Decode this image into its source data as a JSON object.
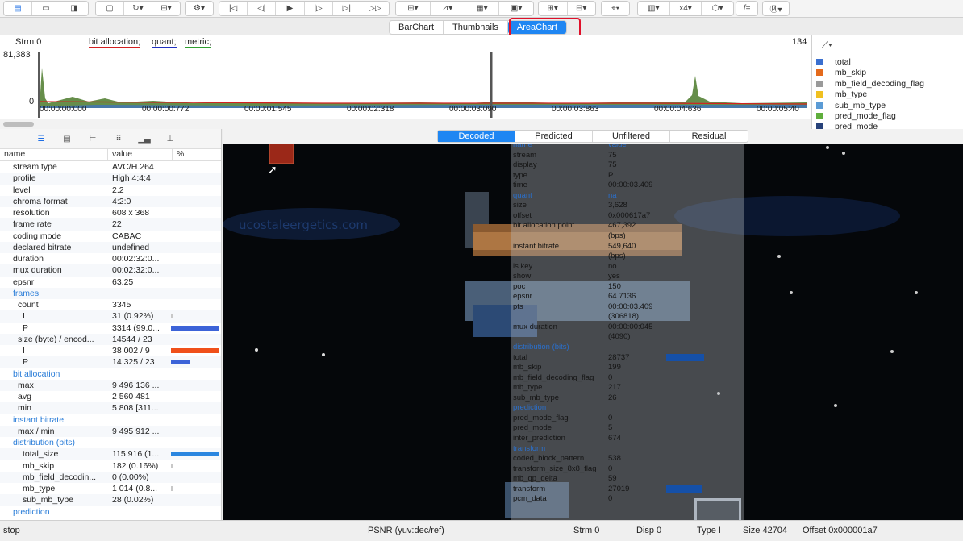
{
  "toolbar": {
    "zoom": "x4",
    "formula": "f="
  },
  "view_tabs": [
    "BarChart",
    "Thumbnails",
    "AreaChart"
  ],
  "chart": {
    "stream_label": "Strm 0",
    "legend_inline": [
      "bit allocation;",
      "quant;",
      "metric;"
    ],
    "right_value": "134",
    "y_max": "81,383",
    "y_zero": "0",
    "time_ticks": [
      "00:00:00:000",
      "00:00:00:772",
      "00:00:01:545",
      "00:00:02:318",
      "00:00:03:090",
      "00:00:03:863",
      "00:00:04:636",
      "00:00:05:40"
    ]
  },
  "legend": [
    {
      "label": "total",
      "color": "#3a6fcf"
    },
    {
      "label": "mb_skip",
      "color": "#e46a1c"
    },
    {
      "label": "mb_field_decoding_flag",
      "color": "#9a9a9a"
    },
    {
      "label": "mb_type",
      "color": "#f0c020"
    },
    {
      "label": "sub_mb_type",
      "color": "#5b9bd5"
    },
    {
      "label": "pred_mode_flag",
      "color": "#5fae3c"
    },
    {
      "label": "pred_mode",
      "color": "#27427a"
    }
  ],
  "props": {
    "head_name": "name",
    "head_value": "value",
    "head_pct": "%",
    "rows": [
      {
        "name": "stream type",
        "value": "AVC/H.264",
        "indent": 1
      },
      {
        "name": "profile",
        "value": "High 4:4:4",
        "indent": 1
      },
      {
        "name": "level",
        "value": "2.2",
        "indent": 1
      },
      {
        "name": "chroma format",
        "value": "4:2:0",
        "indent": 1
      },
      {
        "name": "resolution",
        "value": "608 x 368",
        "indent": 1
      },
      {
        "name": "frame rate",
        "value": "22",
        "indent": 1
      },
      {
        "name": "coding mode",
        "value": "CABAC",
        "indent": 1
      },
      {
        "name": "declared bitrate",
        "value": "undefined",
        "indent": 1
      },
      {
        "name": "duration",
        "value": "00:02:32:0...",
        "indent": 1
      },
      {
        "name": "mux duration",
        "value": "00:02:32:0...",
        "indent": 1
      },
      {
        "name": "epsnr",
        "value": "63.25",
        "indent": 1
      },
      {
        "name": "frames",
        "value": "",
        "indent": 1,
        "section": true
      },
      {
        "name": "count",
        "value": "3345",
        "indent": 2
      },
      {
        "name": "I",
        "value": "31 (0.92%)",
        "indent": 3,
        "bar": 0.01,
        "barColor": "#c8c8c8"
      },
      {
        "name": "P",
        "value": "3314 (99.0...",
        "indent": 3,
        "bar": 0.99,
        "barColor": "#3c63d8"
      },
      {
        "name": "size (byte) / encod...",
        "value": "14544 / 23",
        "indent": 2
      },
      {
        "name": "I",
        "value": "38 002 / 9",
        "indent": 3,
        "bar": 1.0,
        "barColor": "#f0501a"
      },
      {
        "name": "P",
        "value": "14 325 / 23",
        "indent": 3,
        "bar": 0.38,
        "barColor": "#3c63d8"
      },
      {
        "name": "bit allocation",
        "value": "",
        "indent": 1,
        "section": true
      },
      {
        "name": "max",
        "value": "9 496 136 ...",
        "indent": 2
      },
      {
        "name": "avg",
        "value": "2 560 481",
        "indent": 2
      },
      {
        "name": "min",
        "value": "5 808 [311...",
        "indent": 2
      },
      {
        "name": "instant bitrate",
        "value": "",
        "indent": 1,
        "section": true
      },
      {
        "name": "max / min",
        "value": "9 495 912 ...",
        "indent": 2
      },
      {
        "name": "distribution (bits)",
        "value": "",
        "indent": 1,
        "section": true
      },
      {
        "name": "total_size",
        "value": "115 916 (1...",
        "indent": 3,
        "bar": 1.0,
        "barColor": "#2a86e0"
      },
      {
        "name": "mb_skip",
        "value": "182 (0.16%)",
        "indent": 3,
        "bar": 0.01,
        "barColor": "#c8c8c8"
      },
      {
        "name": "mb_field_decodin...",
        "value": "0 (0.00%)",
        "indent": 3
      },
      {
        "name": "mb_type",
        "value": "1 014 (0.8...",
        "indent": 3,
        "bar": 0.01,
        "barColor": "#c8c8c8"
      },
      {
        "name": "sub_mb_type",
        "value": "28 (0.02%)",
        "indent": 3
      },
      {
        "name": "prediction",
        "value": "",
        "indent": 1,
        "section": true
      }
    ]
  },
  "video_tabs": [
    "Decoded",
    "Predicted",
    "Unfiltered",
    "Residual"
  ],
  "overlay": {
    "rows": [
      {
        "k": "name",
        "v": "value",
        "s": true
      },
      {
        "k": "stream",
        "v": "75"
      },
      {
        "k": "display",
        "v": "75"
      },
      {
        "k": "type",
        "v": "P"
      },
      {
        "k": "time",
        "v": "00:00:03.409"
      },
      {
        "k": "quant",
        "v": "na",
        "s": true
      },
      {
        "k": "size",
        "v": "3,628"
      },
      {
        "k": "offset",
        "v": "0x000617a7"
      },
      {
        "k": "bit allocation point",
        "v": "467,392"
      },
      {
        "k": "",
        "v": "(bps)"
      },
      {
        "k": "instant bitrate",
        "v": "549,640"
      },
      {
        "k": "",
        "v": "(bps)"
      },
      {
        "k": "is key",
        "v": "no"
      },
      {
        "k": "show",
        "v": "yes"
      },
      {
        "k": "poc",
        "v": "150"
      },
      {
        "k": "epsnr",
        "v": "64.7136"
      },
      {
        "k": "pts",
        "v": "00:00:03.409"
      },
      {
        "k": "",
        "v": "(306818)"
      },
      {
        "k": "mux duration",
        "v": "00:00:00:045"
      },
      {
        "k": "",
        "v": "(4090)"
      },
      {
        "k": "distribution (bits)",
        "v": "",
        "s": true
      },
      {
        "k": "total",
        "v": "28737",
        "bar": 0.9
      },
      {
        "k": "mb_skip",
        "v": "199"
      },
      {
        "k": "mb_field_decoding_flag",
        "v": "0"
      },
      {
        "k": "mb_type",
        "v": "217"
      },
      {
        "k": "sub_mb_type",
        "v": "26"
      },
      {
        "k": "prediction",
        "v": "",
        "s": true
      },
      {
        "k": "pred_mode_flag",
        "v": "0"
      },
      {
        "k": "pred_mode",
        "v": "5"
      },
      {
        "k": "inter_prediction",
        "v": "674"
      },
      {
        "k": "transform",
        "v": "",
        "s": true
      },
      {
        "k": "coded_block_pattern",
        "v": "538"
      },
      {
        "k": "transform_size_8x8_flag",
        "v": "0"
      },
      {
        "k": "mb_qp_delta",
        "v": "59"
      },
      {
        "k": "transform",
        "v": "27019",
        "bar": 0.85
      },
      {
        "k": "pcm_data",
        "v": "0"
      }
    ]
  },
  "status": {
    "left": "stop",
    "psnr": "PSNR (yuv:dec/ref)",
    "strm": "Strm 0",
    "disp": "Disp 0",
    "type": "Type I",
    "size": "Size 42704",
    "offset": "Offset 0x000001a7"
  }
}
